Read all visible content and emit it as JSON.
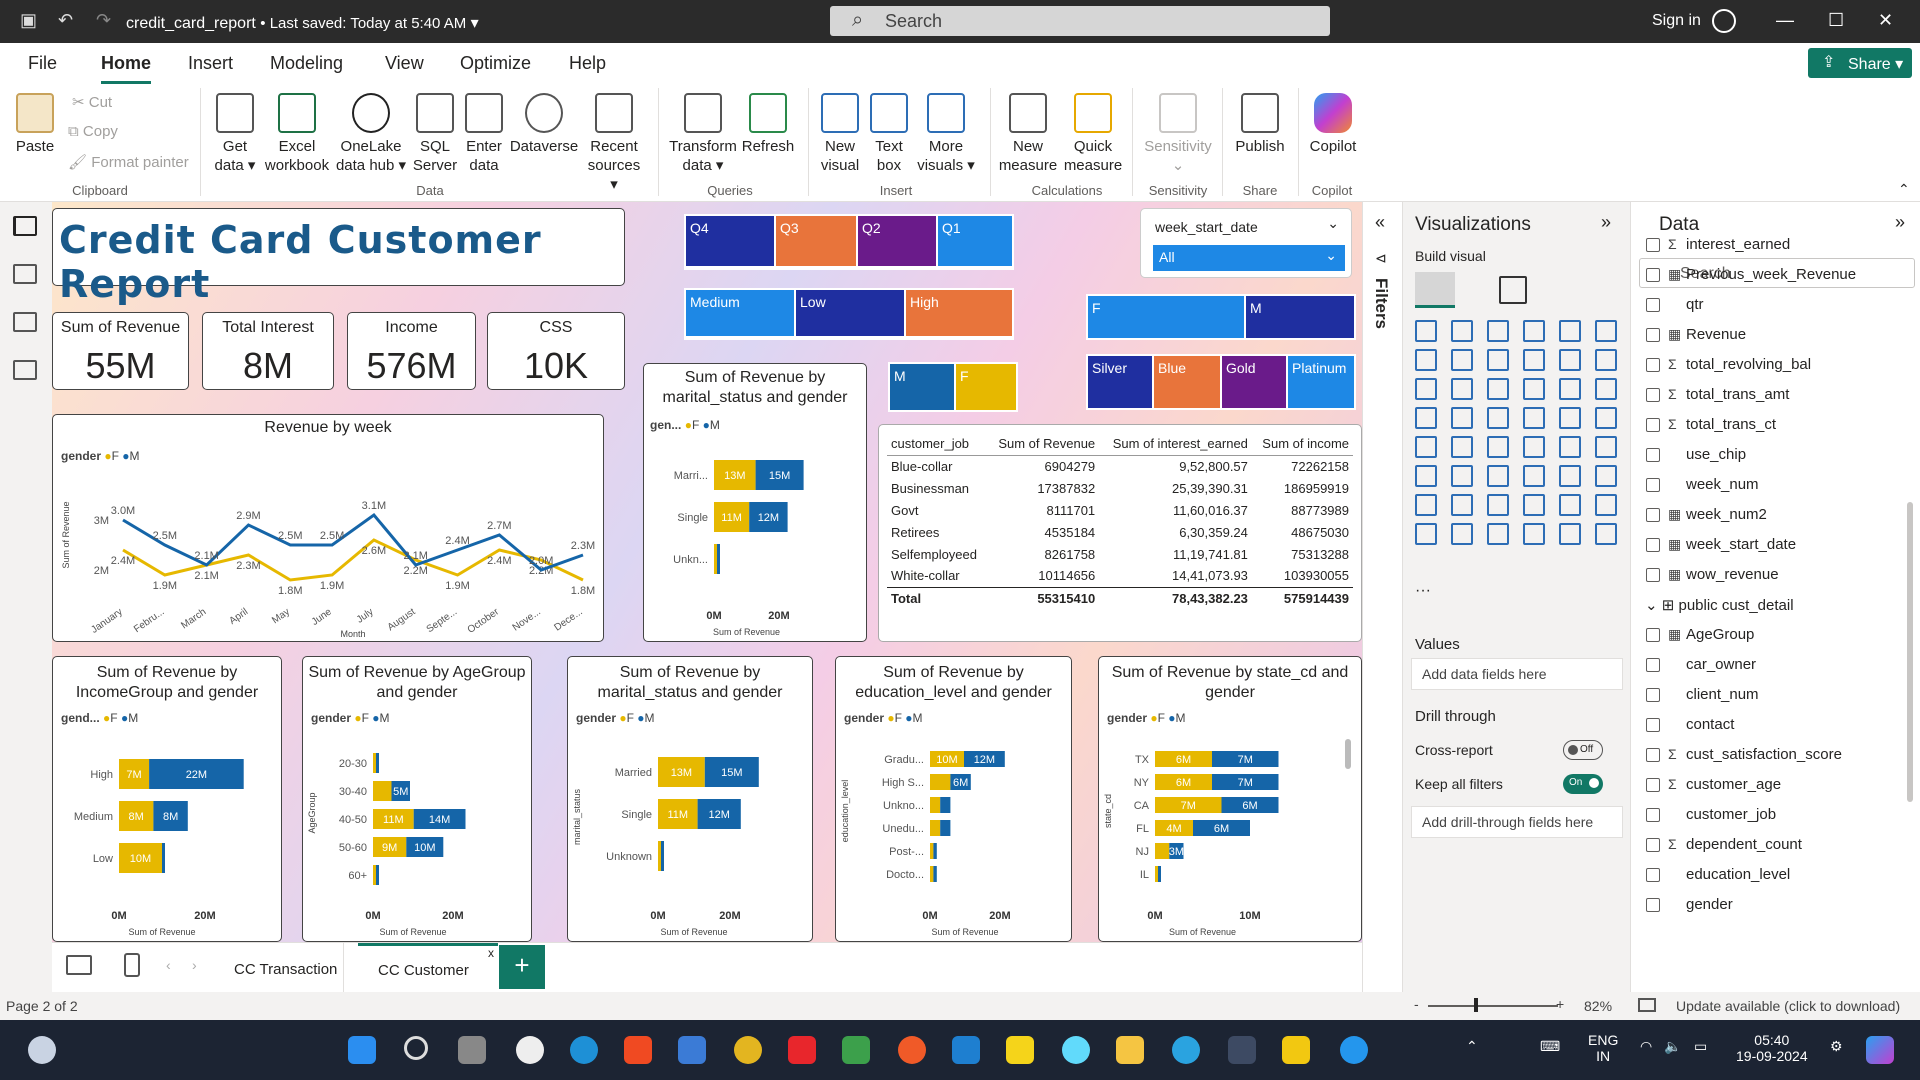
{
  "window": {
    "title": "credit_card_report",
    "saved": "• Last saved: Today at 5:40 AM",
    "search": "Search",
    "signin": "Sign in"
  },
  "menu": [
    "File",
    "Home",
    "Insert",
    "Modeling",
    "View",
    "Optimize",
    "Help"
  ],
  "share": "Share",
  "ribbon": {
    "paste": "Paste",
    "cut": "Cut",
    "copy": "Copy",
    "format_painter": "Format painter",
    "get_data": "Get data",
    "excel": "Excel workbook",
    "onelake": "OneLake data hub",
    "sql": "SQL Server",
    "enter": "Enter data",
    "dataverse": "Dataverse",
    "recent": "Recent sources",
    "transform": "Transform data",
    "refresh": "Refresh",
    "new_visual": "New visual",
    "text_box": "Text box",
    "more_visuals": "More visuals",
    "new_measure": "New measure",
    "quick_measure": "Quick measure",
    "sensitivity": "Sensitivity",
    "publish": "Publish",
    "copilot": "Copilot",
    "groups": {
      "clipboard": "Clipboard",
      "data": "Data",
      "queries": "Queries",
      "insert": "Insert",
      "calculations": "Calculations",
      "sensitivity": "Sensitivity",
      "share": "Share",
      "copilot": "Copilot"
    }
  },
  "report": {
    "title": "Credit Card Customer Report",
    "kpis": [
      {
        "label": "Sum of Revenue",
        "value": "55M"
      },
      {
        "label": "Total Interest",
        "value": "8M"
      },
      {
        "label": "Income",
        "value": "576M"
      },
      {
        "label": "CSS",
        "value": "10K"
      }
    ],
    "slicer_q": [
      "Q4",
      "Q3",
      "Q2",
      "Q1"
    ],
    "slicer_income": [
      "Medium",
      "Low",
      "High"
    ],
    "slicer_gender_small": [
      "M",
      "F"
    ],
    "slicer_date": {
      "label": "week_start_date",
      "value": "All"
    },
    "slicer_gender": [
      "F",
      "M"
    ],
    "slicer_card": [
      "Silver",
      "Blue",
      "Gold",
      "Platinum"
    ],
    "colors": {
      "navy": "#1f2fa0",
      "orange": "#e8743b",
      "purple": "#6a1b8a",
      "blue": "#1e88e5",
      "gold": "#e6b800",
      "teal": "#1565a8"
    },
    "table": {
      "headers": [
        "customer_job",
        "Sum of Revenue",
        "Sum of interest_earned",
        "Sum of income"
      ],
      "rows": [
        [
          "Blue-collar",
          "6904279",
          "9,52,800.57",
          "72262158"
        ],
        [
          "Businessman",
          "17387832",
          "25,39,390.31",
          "186959919"
        ],
        [
          "Govt",
          "8111701",
          "11,60,016.37",
          "88773989"
        ],
        [
          "Retirees",
          "4535184",
          "6,30,359.24",
          "48675030"
        ],
        [
          "Selfemployeed",
          "8261758",
          "11,19,741.81",
          "75313288"
        ],
        [
          "White-collar",
          "10114656",
          "14,41,073.93",
          "103930055"
        ]
      ],
      "total": [
        "Total",
        "55315410",
        "78,43,382.23",
        "575914439"
      ]
    }
  },
  "chart_data": [
    {
      "type": "line",
      "title": "Revenue by week",
      "xlabel": "Month",
      "ylabel": "Sum of Revenue",
      "legend_title": "gender",
      "legend": [
        "F",
        "M"
      ],
      "categories": [
        "January",
        "Febru...",
        "March",
        "April",
        "May",
        "June",
        "July",
        "August",
        "Septe...",
        "October",
        "Nove...",
        "Dece..."
      ],
      "series": [
        {
          "name": "F",
          "values": [
            2.4,
            1.9,
            2.1,
            2.3,
            1.8,
            1.9,
            2.6,
            2.2,
            1.9,
            2.4,
            2.2,
            1.8
          ]
        },
        {
          "name": "M",
          "values": [
            3.0,
            2.5,
            2.1,
            2.9,
            2.5,
            2.5,
            3.1,
            2.1,
            2.4,
            2.7,
            2.0,
            2.3
          ]
        }
      ],
      "ticks": [
        "2M",
        "3M"
      ]
    },
    {
      "type": "bar",
      "title": "Sum of Revenue by marital_status and gender",
      "legend_title": "gen...",
      "categories": [
        "Marri...",
        "Single",
        "Unkn..."
      ],
      "series": [
        {
          "name": "F",
          "values": [
            13,
            11,
            0.5
          ]
        },
        {
          "name": "M",
          "values": [
            15,
            12,
            0.5
          ]
        }
      ],
      "labels": [
        [
          "13M",
          "15M"
        ],
        [
          "11M",
          "12M"
        ],
        [
          "",
          ""
        ]
      ],
      "xlabel": "Sum of Revenue",
      "ticks": [
        "0M",
        "20M"
      ]
    },
    {
      "type": "bar",
      "title": "Sum of Revenue by IncomeGroup and gender",
      "legend_title": "gend...",
      "categories": [
        "High",
        "Medium",
        "Low"
      ],
      "series": [
        {
          "name": "F",
          "values": [
            7,
            8,
            10
          ]
        },
        {
          "name": "M",
          "values": [
            22,
            8,
            0.5
          ]
        }
      ],
      "labels": [
        [
          "7M",
          "22M"
        ],
        [
          "8M",
          "8M"
        ],
        [
          "10M",
          ""
        ]
      ],
      "xlabel": "Sum of Revenue",
      "ticks": [
        "0M",
        "20M"
      ]
    },
    {
      "type": "bar",
      "title": "Sum of Revenue by AgeGroup and gender",
      "legend_title": "gender",
      "ylabel": "AgeGroup",
      "categories": [
        "20-30",
        "30-40",
        "40-50",
        "50-60",
        "60+"
      ],
      "series": [
        {
          "name": "F",
          "values": [
            0.3,
            5,
            11,
            9,
            0.7
          ]
        },
        {
          "name": "M",
          "values": [
            0.3,
            5,
            14,
            10,
            0.7
          ]
        }
      ],
      "labels": [
        [
          "",
          ""
        ],
        [
          "",
          "5M"
        ],
        [
          "11M",
          "14M"
        ],
        [
          "9M",
          "10M"
        ],
        [
          "",
          ""
        ]
      ],
      "xlabel": "Sum of Revenue",
      "ticks": [
        "0M",
        "20M"
      ]
    },
    {
      "type": "bar",
      "title": "Sum of Revenue by marital_status and gender",
      "legend_title": "gender",
      "ylabel": "marital_status",
      "categories": [
        "Married",
        "Single",
        "Unknown"
      ],
      "series": [
        {
          "name": "F",
          "values": [
            13,
            11,
            0.5
          ]
        },
        {
          "name": "M",
          "values": [
            15,
            12,
            0.5
          ]
        }
      ],
      "labels": [
        [
          "13M",
          "15M"
        ],
        [
          "11M",
          "12M"
        ],
        [
          "",
          ""
        ]
      ],
      "xlabel": "Sum of Revenue",
      "ticks": [
        "0M",
        "20M"
      ]
    },
    {
      "type": "bar",
      "title": "Sum of Revenue by education_level and gender",
      "legend_title": "gender",
      "ylabel": "education_level",
      "categories": [
        "Gradu...",
        "High S...",
        "Unkno...",
        "Unedu...",
        "Post-...",
        "Docto..."
      ],
      "series": [
        {
          "name": "F",
          "values": [
            10,
            6,
            3,
            3,
            1,
            1
          ]
        },
        {
          "name": "M",
          "values": [
            12,
            6,
            3,
            3,
            1,
            1
          ]
        }
      ],
      "labels": [
        [
          "10M",
          "12M"
        ],
        [
          "",
          "6M"
        ],
        [
          "",
          ""
        ],
        [
          "",
          ""
        ],
        [
          "",
          ""
        ],
        [
          "",
          ""
        ]
      ],
      "xlabel": "Sum of Revenue",
      "ticks": [
        "0M",
        "20M"
      ]
    },
    {
      "type": "bar",
      "title": "Sum of Revenue by state_cd and gender",
      "legend_title": "gender",
      "ylabel": "state_cd",
      "categories": [
        "TX",
        "NY",
        "CA",
        "FL",
        "NJ",
        "IL"
      ],
      "series": [
        {
          "name": "F",
          "values": [
            6,
            6,
            7,
            4,
            1.5,
            0.3
          ]
        },
        {
          "name": "M",
          "values": [
            7,
            7,
            6,
            6,
            1.5,
            0.3
          ]
        }
      ],
      "labels": [
        [
          "6M",
          "7M"
        ],
        [
          "6M",
          "7M"
        ],
        [
          "7M",
          "6M"
        ],
        [
          "4M",
          "6M"
        ],
        [
          "",
          "3M"
        ],
        [
          "",
          ""
        ]
      ],
      "xlabel": "Sum of Revenue",
      "ticks": [
        "0M",
        "10M"
      ]
    }
  ],
  "panes": {
    "filters": "Filters",
    "viz": "Visualizations",
    "build": "Build visual",
    "values": "Values",
    "values_ph": "Add data fields here",
    "drill": "Drill through",
    "cross": "Cross-report",
    "cross_state": "Off",
    "keep": "Keep all filters",
    "keep_state": "On",
    "drill_ph": "Add drill-through fields here",
    "data": "Data",
    "data_search": "Search",
    "fields": [
      {
        "t": "Σ",
        "n": "interest_earned"
      },
      {
        "t": "▦",
        "n": "Previous_week_Revenue"
      },
      {
        "t": "",
        "n": "qtr"
      },
      {
        "t": "▦",
        "n": "Revenue"
      },
      {
        "t": "Σ",
        "n": "total_revolving_bal"
      },
      {
        "t": "Σ",
        "n": "total_trans_amt"
      },
      {
        "t": "Σ",
        "n": "total_trans_ct"
      },
      {
        "t": "",
        "n": "use_chip"
      },
      {
        "t": "",
        "n": "week_num"
      },
      {
        "t": "▦",
        "n": "week_num2"
      },
      {
        "t": "▦",
        "n": "week_start_date"
      },
      {
        "t": "▦",
        "n": "wow_revenue"
      }
    ],
    "table2": "public cust_detail",
    "fields2": [
      {
        "t": "▦",
        "n": "AgeGroup"
      },
      {
        "t": "",
        "n": "car_owner"
      },
      {
        "t": "",
        "n": "client_num"
      },
      {
        "t": "",
        "n": "contact"
      },
      {
        "t": "Σ",
        "n": "cust_satisfaction_score"
      },
      {
        "t": "Σ",
        "n": "customer_age"
      },
      {
        "t": "",
        "n": "customer_job"
      },
      {
        "t": "Σ",
        "n": "dependent_count"
      },
      {
        "t": "",
        "n": "education_level"
      },
      {
        "t": "",
        "n": "gender"
      }
    ]
  },
  "tabs": [
    "CC Transaction",
    "CC Customer"
  ],
  "status": {
    "page": "Page 2 of 2",
    "zoom": "82%",
    "update": "Update available (click to download)"
  },
  "taskbar": {
    "lang1": "ENG",
    "lang2": "IN",
    "time": "05:40",
    "date": "19-09-2024"
  }
}
